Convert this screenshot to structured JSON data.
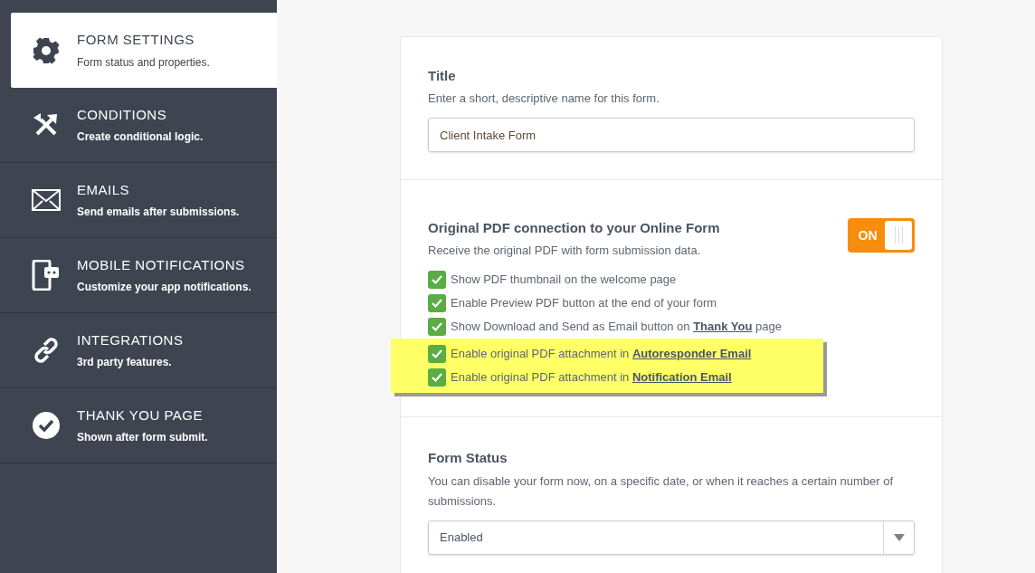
{
  "sidebar": {
    "items": [
      {
        "kind": "gear",
        "title": "FORM SETTINGS",
        "subtitle": "Form status and properties.",
        "selected": true
      },
      {
        "kind": "conditions",
        "title": "CONDITIONS",
        "subtitle": "Create conditional logic.",
        "selected": false
      },
      {
        "kind": "mail",
        "title": "EMAILS",
        "subtitle": "Send emails after submissions.",
        "selected": false
      },
      {
        "kind": "mobile",
        "title": "MOBILE NOTIFICATIONS",
        "subtitle": "Customize your app notifications.",
        "selected": false
      },
      {
        "kind": "link",
        "title": "INTEGRATIONS",
        "subtitle": "3rd party features.",
        "selected": false
      },
      {
        "kind": "check",
        "title": "THANK YOU PAGE",
        "subtitle": "Shown after form submit.",
        "selected": false
      }
    ]
  },
  "title_section": {
    "heading": "Title",
    "description": "Enter a short, descriptive name for this form.",
    "value": "Client Intake Form"
  },
  "pdf_section": {
    "heading": "Original PDF connection to your Online Form",
    "description": "Receive the original PDF with form submission data.",
    "toggle": {
      "label": "ON",
      "on": true
    },
    "options": [
      {
        "text": "Show PDF thumbnail on the welcome page",
        "checked": true,
        "highlighted": false
      },
      {
        "text": "Enable Preview PDF button at the end of your form",
        "checked": true,
        "highlighted": false
      },
      {
        "text": "Show Download and Send as Email button on ",
        "link": "Thank You",
        "after": " page",
        "checked": true,
        "highlighted": false
      },
      {
        "text": "Enable original PDF attachment in ",
        "link": "Autoresponder Email",
        "checked": true,
        "highlighted": true
      },
      {
        "text": "Enable original PDF attachment in ",
        "link": "Notification Email",
        "checked": true,
        "highlighted": true
      }
    ]
  },
  "status_section": {
    "heading": "Form Status",
    "description": "You can disable your form now, on a specific date, or when it reaches a certain number of submissions.",
    "value": "Enabled"
  }
}
